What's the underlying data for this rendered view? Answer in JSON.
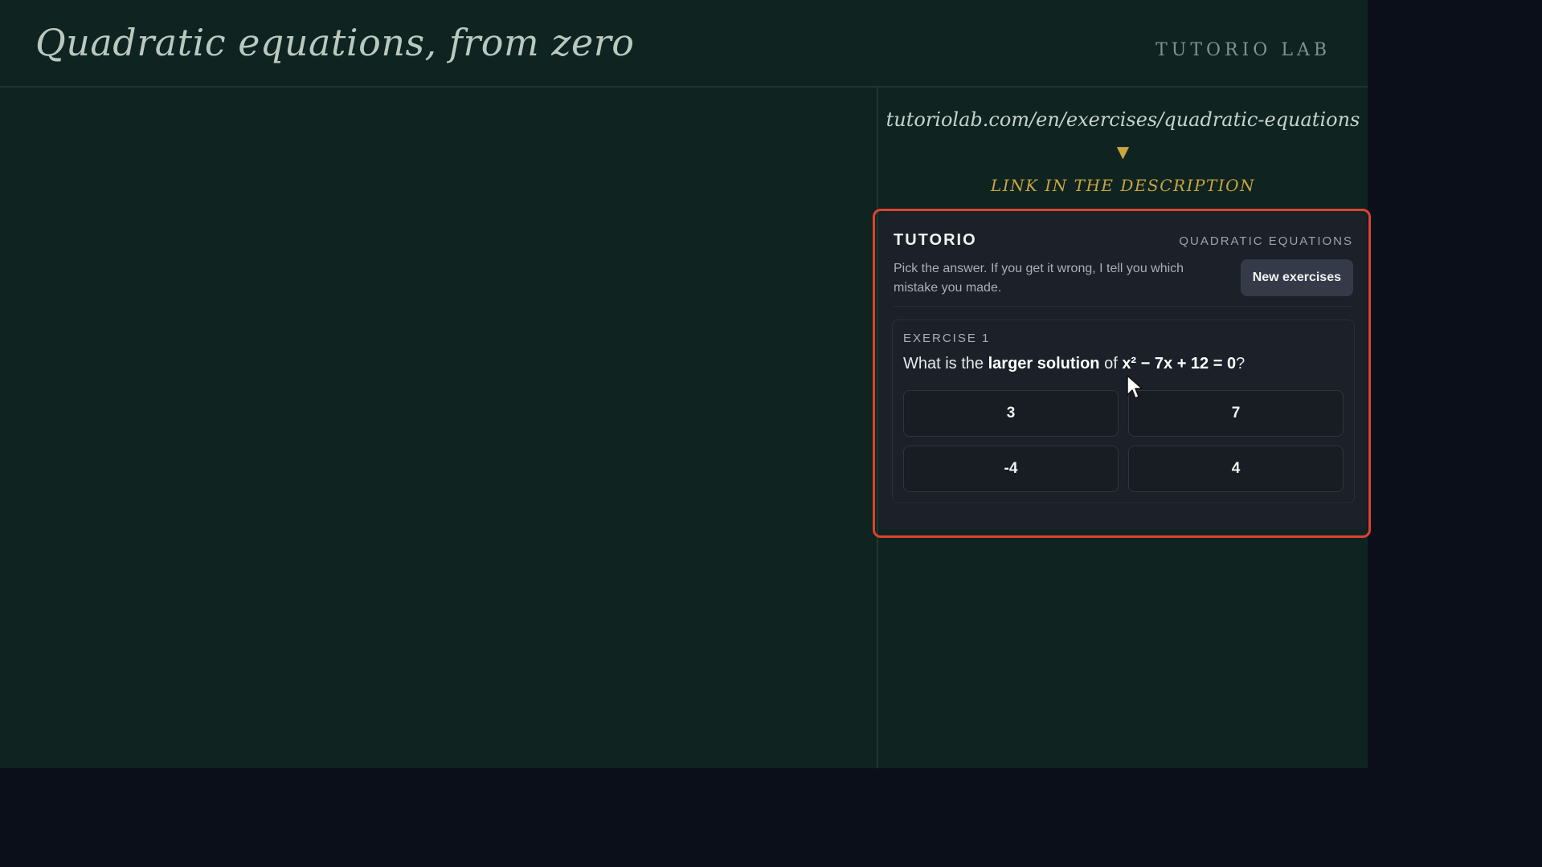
{
  "header": {
    "title": "Quadratic equations, from zero",
    "brand": "TUTORIO LAB"
  },
  "promo": {
    "url": "tutoriolab.com/en/exercises/quadratic-equations",
    "arrow": "▼",
    "link_text": "LINK IN THE DESCRIPTION"
  },
  "widget": {
    "brand": "TUTORIO",
    "topic": "QUADRATIC EQUATIONS",
    "instructions": "Pick the answer. If you get it wrong, I tell you which mistake you made.",
    "new_button_label": "New exercises",
    "exercise": {
      "label": "EXERCISE 1",
      "question_prefix": "What is the ",
      "question_emphasis": "larger solution",
      "question_middle": " of ",
      "question_equation": "x² − 7x + 12 = 0",
      "question_suffix": "?",
      "answers": [
        "3",
        "7",
        "-4",
        "4"
      ]
    }
  },
  "colors": {
    "background": "#0f2420",
    "outer_background": "#0b0f1a",
    "accent_gold": "#c9a441",
    "highlight_red": "#e0412f",
    "widget_bg": "#1b2029"
  },
  "icons": {
    "cursor": "mouse-pointer-icon",
    "arrow": "down-triangle-icon"
  }
}
